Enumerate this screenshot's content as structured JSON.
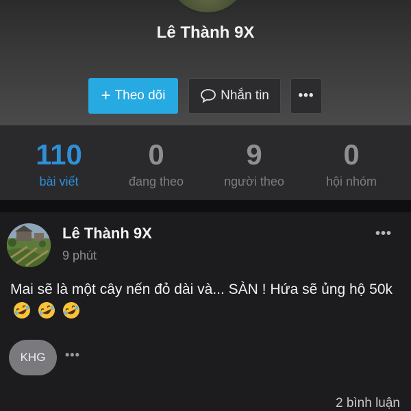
{
  "profile": {
    "name": "Lê Thành 9X"
  },
  "actions": {
    "follow_label": "Theo dõi",
    "message_label": "Nhắn tin",
    "more_label": "•••"
  },
  "stats": [
    {
      "value": "110",
      "label": "bài viết",
      "active": true
    },
    {
      "value": "0",
      "label": "đang theo",
      "active": false
    },
    {
      "value": "9",
      "label": "người theo",
      "active": false
    },
    {
      "value": "0",
      "label": "hội nhóm",
      "active": false
    }
  ],
  "post": {
    "author": "Lê Thành 9X",
    "time": "9 phút",
    "more_label": "•••",
    "body_text": "Mai sẽ là một cây nến đỏ dài và... SÀN ! Hứa sẽ ủng hộ 50k",
    "emojis": [
      "rofl-emoji",
      "rofl-emoji",
      "rofl-emoji"
    ],
    "reactor_initials": "KHG",
    "reactor_more": "•••",
    "comments_label": "2 bình luận"
  },
  "colors": {
    "accent": "#27a9e1",
    "stat_active": "#2f8fd8"
  }
}
